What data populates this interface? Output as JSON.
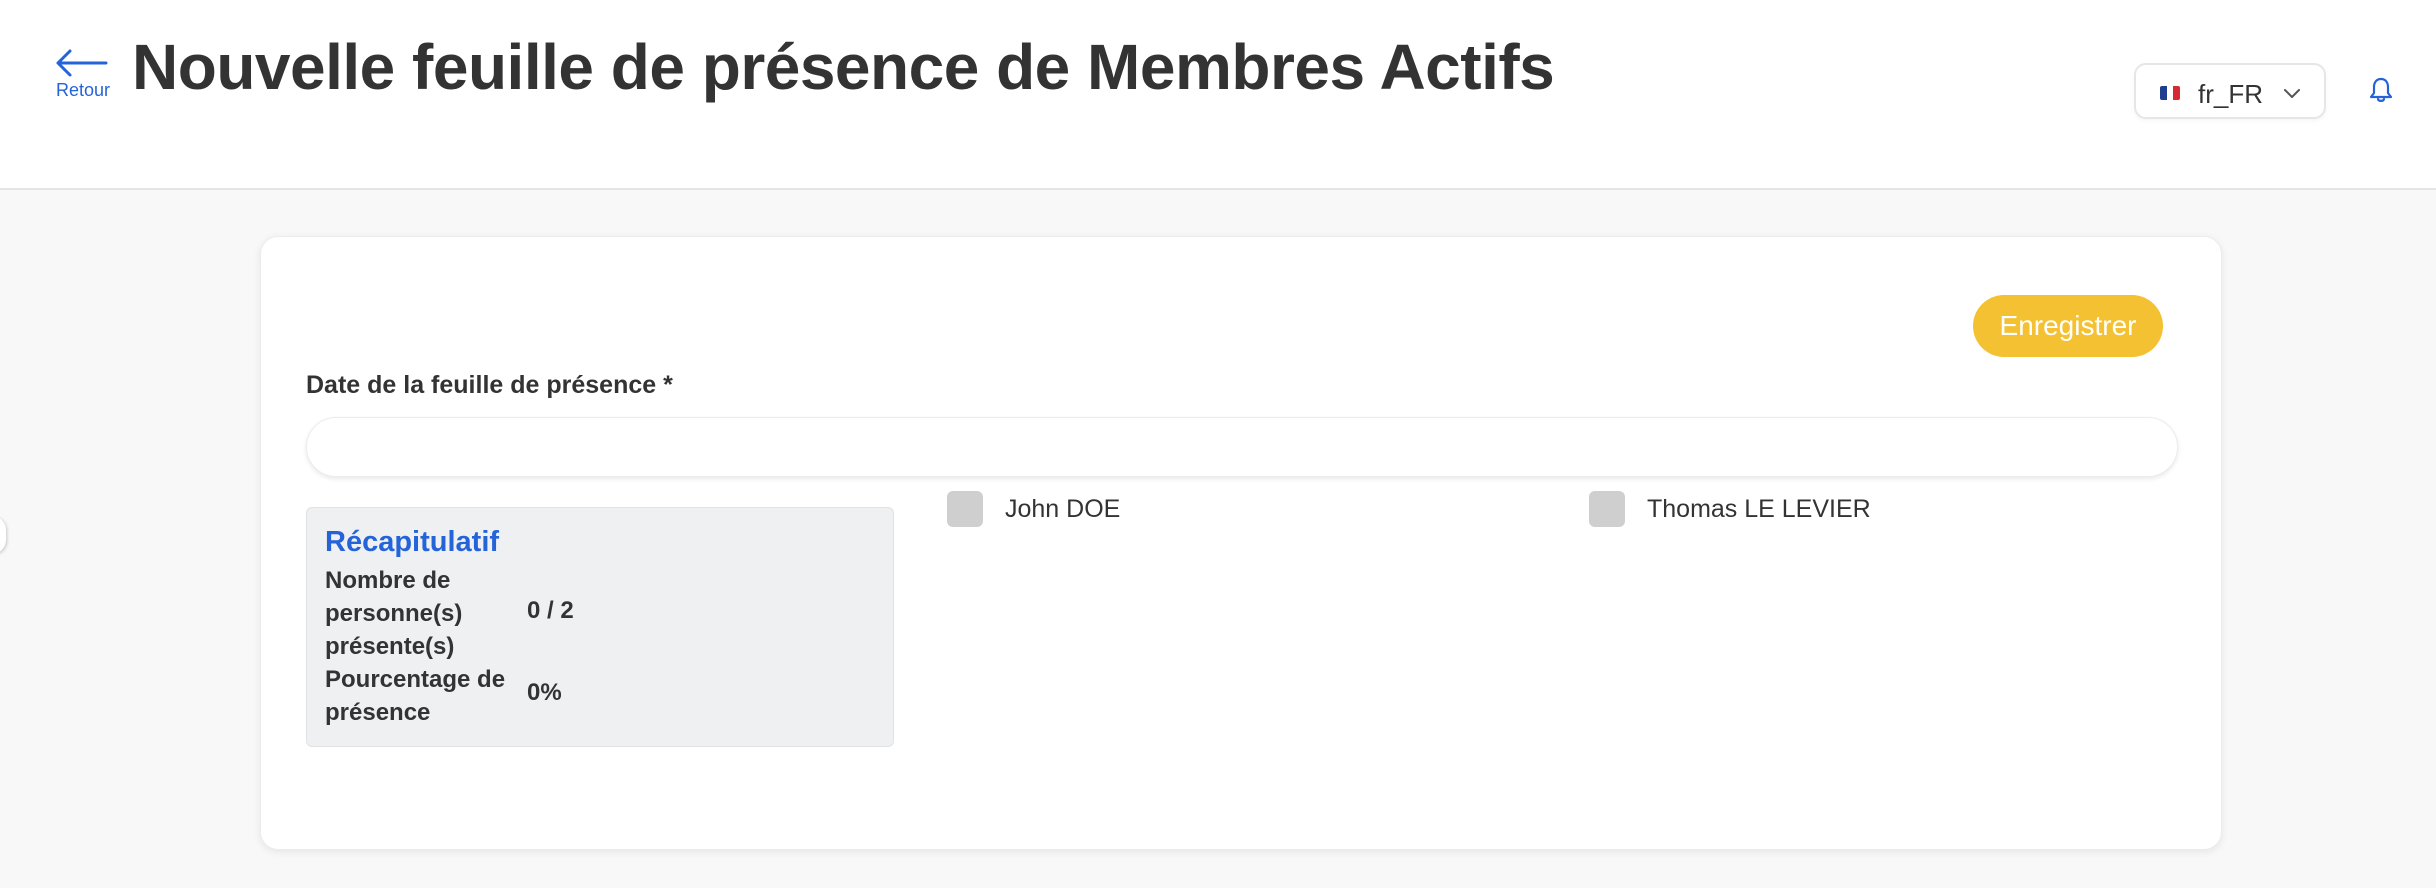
{
  "header": {
    "back_label": "Retour",
    "title": "Nouvelle feuille de présence de Membres Actifs",
    "language": {
      "selected": "fr_FR",
      "flag_icon": "flag-fr-icon"
    },
    "notification_icon": "bell-icon"
  },
  "form": {
    "save_label": "Enregistrer",
    "date_label": "Date de la feuille de présence *",
    "date_value": ""
  },
  "summary": {
    "title": "Récapitulatif",
    "present_label": "Nombre de personne(s) présente(s)",
    "present_value": "0 / 2",
    "percent_label": "Pourcentage de présence",
    "percent_value": "0%"
  },
  "members": [
    {
      "name": "John DOE",
      "present": false
    },
    {
      "name": "Thomas LE LEVIER",
      "present": false
    }
  ],
  "colors": {
    "accent": "#2563d8",
    "save_button": "#f3c131",
    "summary_bg": "#eef0f2",
    "checkbox": "#cfcfcf"
  }
}
